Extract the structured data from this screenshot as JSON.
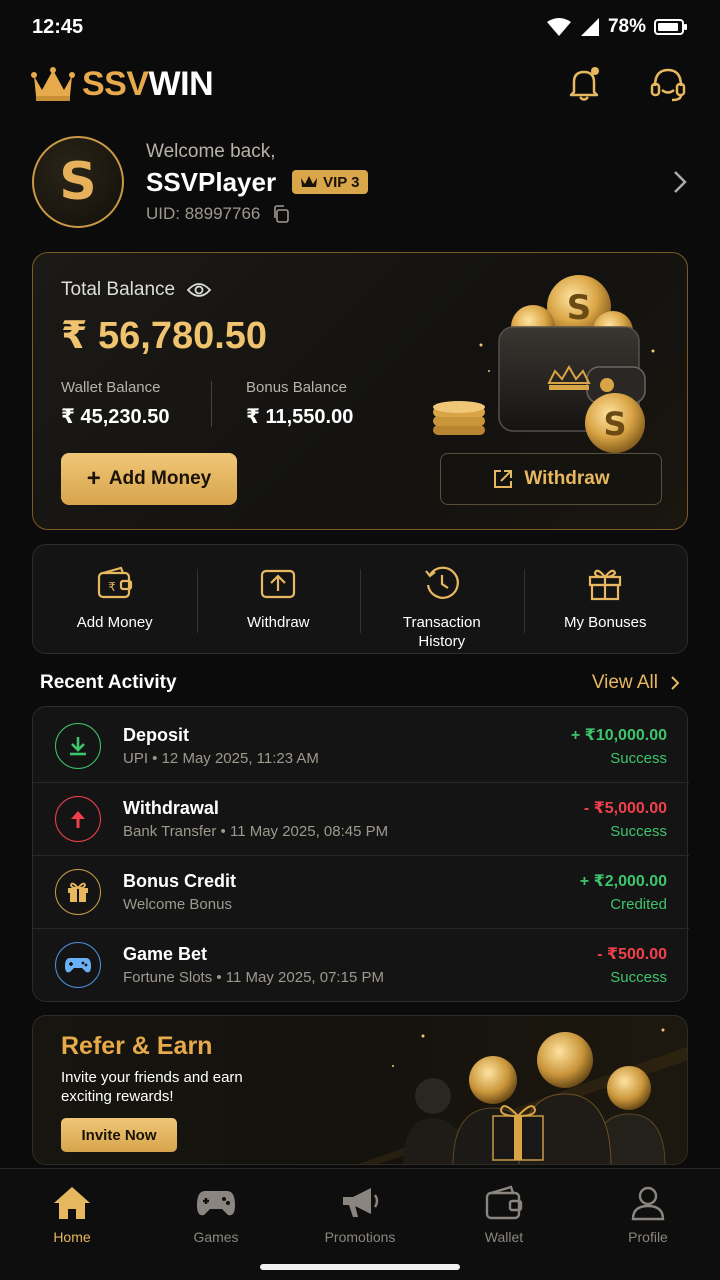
{
  "status_bar": {
    "time": "12:45",
    "battery": "78%"
  },
  "header": {
    "logo_part1": "SSV",
    "logo_part2": "WIN",
    "icons": [
      "bell-icon",
      "headset-icon"
    ]
  },
  "profile": {
    "welcome": "Welcome back,",
    "username": "SSVPlayer",
    "vip": "VIP 3",
    "uid": "UID: 88997766",
    "avatar_letter": "S"
  },
  "balance": {
    "label": "Total Balance",
    "total": "₹ 56,780.50",
    "wallet_label": "Wallet Balance",
    "wallet_value": "₹ 45,230.50",
    "bonus_label": "Bonus Balance",
    "bonus_value": "₹ 11,550.00",
    "add_money": "Add Money",
    "withdraw": "Withdraw"
  },
  "quick_actions": [
    {
      "label": "Add Money",
      "icon": "wallet-rupee-icon"
    },
    {
      "label": "Withdraw",
      "icon": "upload-icon"
    },
    {
      "label": "Transaction History",
      "icon": "history-icon"
    },
    {
      "label": "My Bonuses",
      "icon": "gift-icon"
    }
  ],
  "recent_activity": {
    "title": "Recent Activity",
    "view_all": "View All",
    "items": [
      {
        "title": "Deposit",
        "sub": "UPI • 12 May 2025, 11:23 AM",
        "amount": "+ ₹10,000.00",
        "status": "Success",
        "icon": "download-icon"
      },
      {
        "title": "Withdrawal",
        "sub": "Bank Transfer • 11 May 2025, 08:45 PM",
        "amount": "- ₹5,000.00",
        "status": "Success",
        "icon": "arrow-up-icon"
      },
      {
        "title": "Bonus Credit",
        "sub": "Welcome Bonus",
        "amount": "+ ₹2,000.00",
        "status": "Credited",
        "icon": "gift-icon"
      },
      {
        "title": "Game Bet",
        "sub": "Fortune Slots • 11 May 2025, 07:15 PM",
        "amount": "- ₹500.00",
        "status": "Success",
        "icon": "gamepad-icon"
      }
    ]
  },
  "refer": {
    "title": "Refer & Earn",
    "subtitle": "Invite your friends and earn exciting rewards!",
    "button": "Invite Now"
  },
  "bottom_nav": [
    {
      "label": "Home",
      "icon": "home-icon",
      "active": true
    },
    {
      "label": "Games",
      "icon": "gamepad-icon",
      "active": false
    },
    {
      "label": "Promotions",
      "icon": "megaphone-icon",
      "active": false
    },
    {
      "label": "Wallet",
      "icon": "wallet-icon",
      "active": false
    },
    {
      "label": "Profile",
      "icon": "user-icon",
      "active": false
    }
  ],
  "colors": {
    "gold": "#e8b860",
    "success": "#3ec46d",
    "danger": "#f0414b",
    "background": "#0b0b0b"
  }
}
